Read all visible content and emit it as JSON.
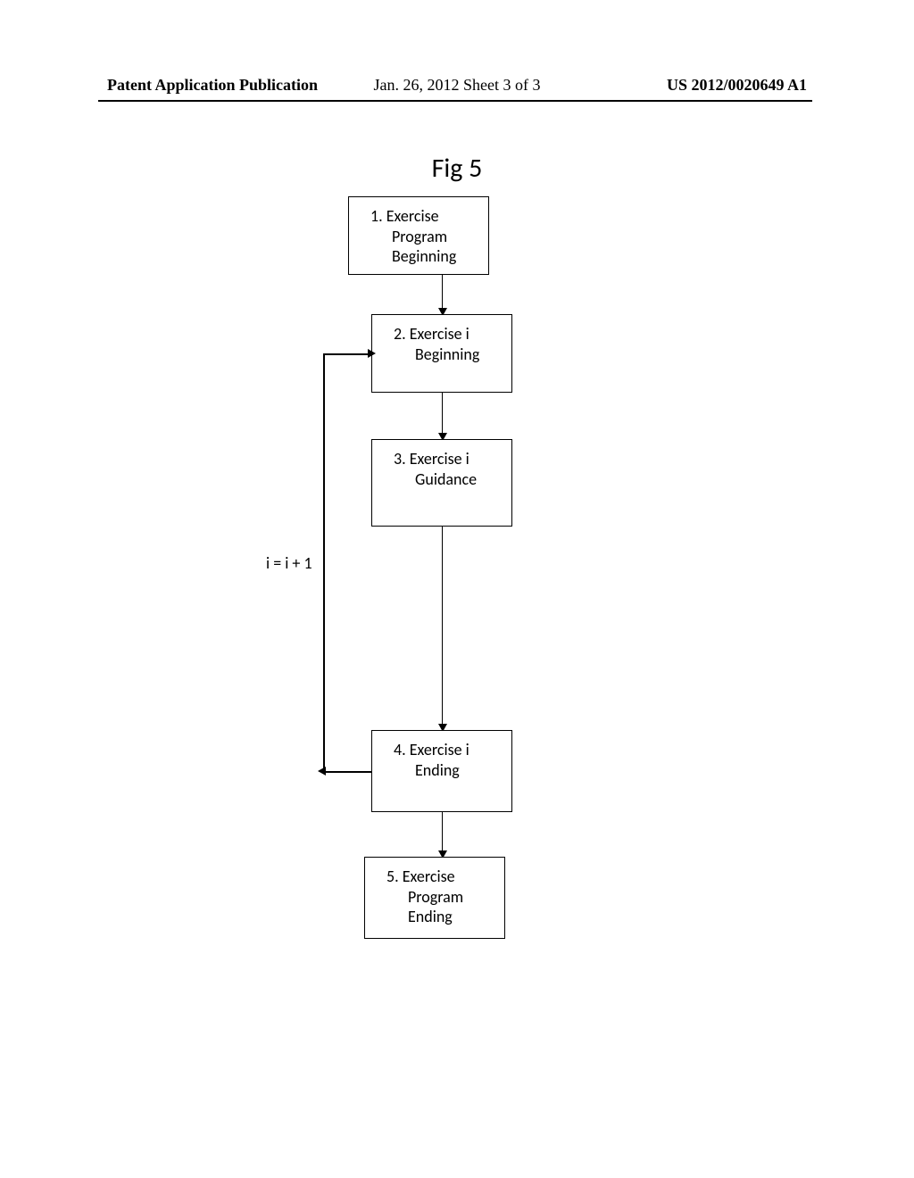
{
  "header": {
    "left": "Patent Application Publication",
    "center": "Jan. 26, 2012  Sheet 3 of 3",
    "right": "US 2012/0020649 A1"
  },
  "figure": {
    "title": "Fig 5"
  },
  "flow": {
    "boxes": {
      "b1": {
        "n": "1.",
        "t": "Exercise",
        "sub1": "Program",
        "sub2": "Beginning"
      },
      "b2": {
        "n": "2.",
        "t": "Exercise i",
        "sub1": "Beginning",
        "sub2": ""
      },
      "b3": {
        "n": "3.",
        "t": "Exercise i",
        "sub1": "Guidance",
        "sub2": ""
      },
      "b4": {
        "n": "4.",
        "t": "Exercise i",
        "sub1": "Ending",
        "sub2": ""
      },
      "b5": {
        "n": "5.",
        "t": "Exercise",
        "sub1": "Program",
        "sub2": "Ending"
      }
    },
    "loop_label": "i = i + 1"
  }
}
